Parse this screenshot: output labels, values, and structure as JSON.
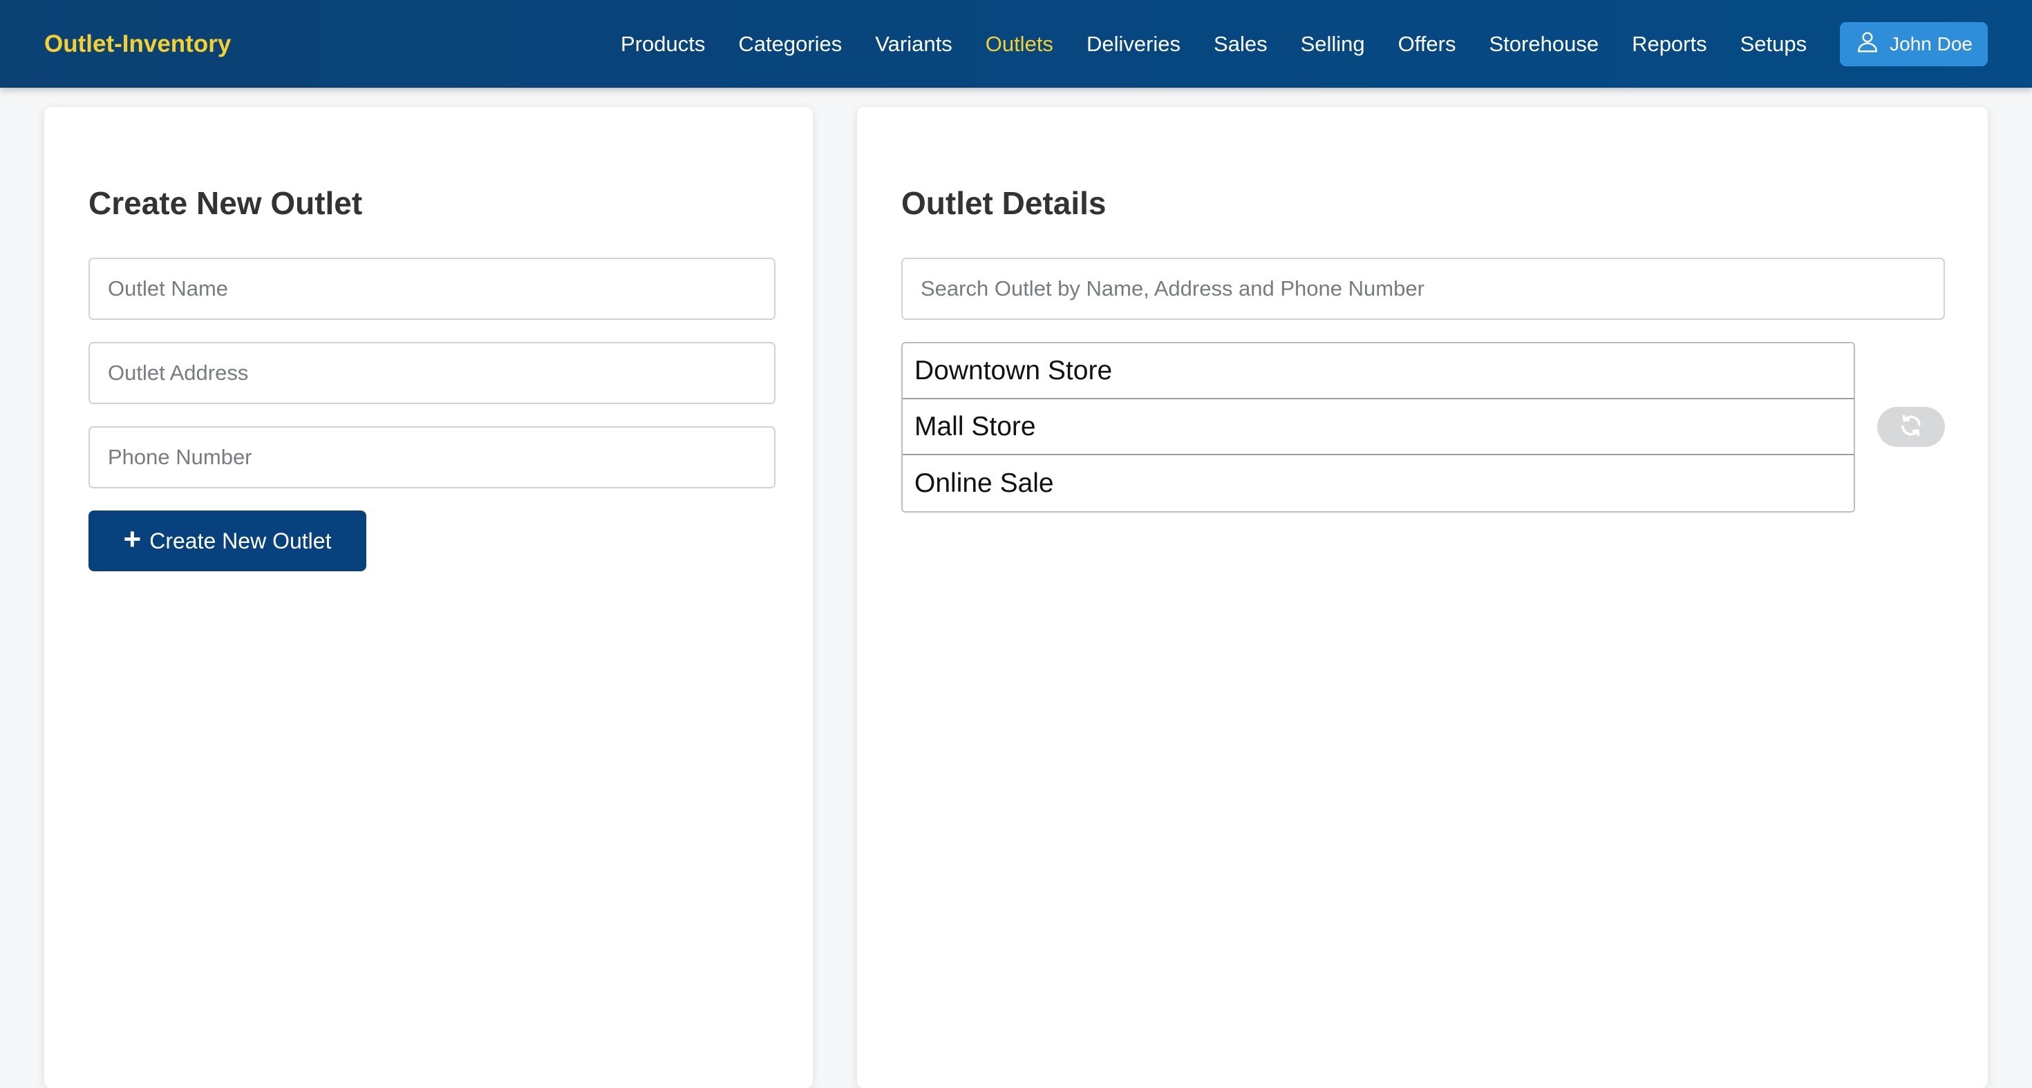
{
  "brand": {
    "name": "Outlet-Inventory"
  },
  "nav": {
    "links": [
      {
        "label": "Products"
      },
      {
        "label": "Categories"
      },
      {
        "label": "Variants"
      },
      {
        "label": "Outlets",
        "active": true
      },
      {
        "label": "Deliveries"
      },
      {
        "label": "Sales"
      },
      {
        "label": "Selling"
      },
      {
        "label": "Offers"
      },
      {
        "label": "Storehouse"
      },
      {
        "label": "Reports"
      },
      {
        "label": "Setups"
      }
    ],
    "user": {
      "name": "John Doe",
      "icon": "user-icon"
    }
  },
  "create_form": {
    "title": "Create New Outlet",
    "name_placeholder": "Outlet Name",
    "address_placeholder": "Outlet Address",
    "phone_placeholder": "Phone Number",
    "submit_label": "Create New Outlet",
    "submit_icon": "plus-icon"
  },
  "details": {
    "title": "Outlet Details",
    "search_placeholder": "Search Outlet by Name, Address and Phone Number",
    "outlets": [
      "Downtown Store",
      "Mall Store",
      "Online Sale"
    ],
    "refresh_icon": "refresh-icon"
  },
  "colors": {
    "navbar": "#07457c",
    "brand": "#f6d12e",
    "active_link": "#f6d12e",
    "user_button": "#2f8ed9",
    "primary_button": "#07427e"
  }
}
